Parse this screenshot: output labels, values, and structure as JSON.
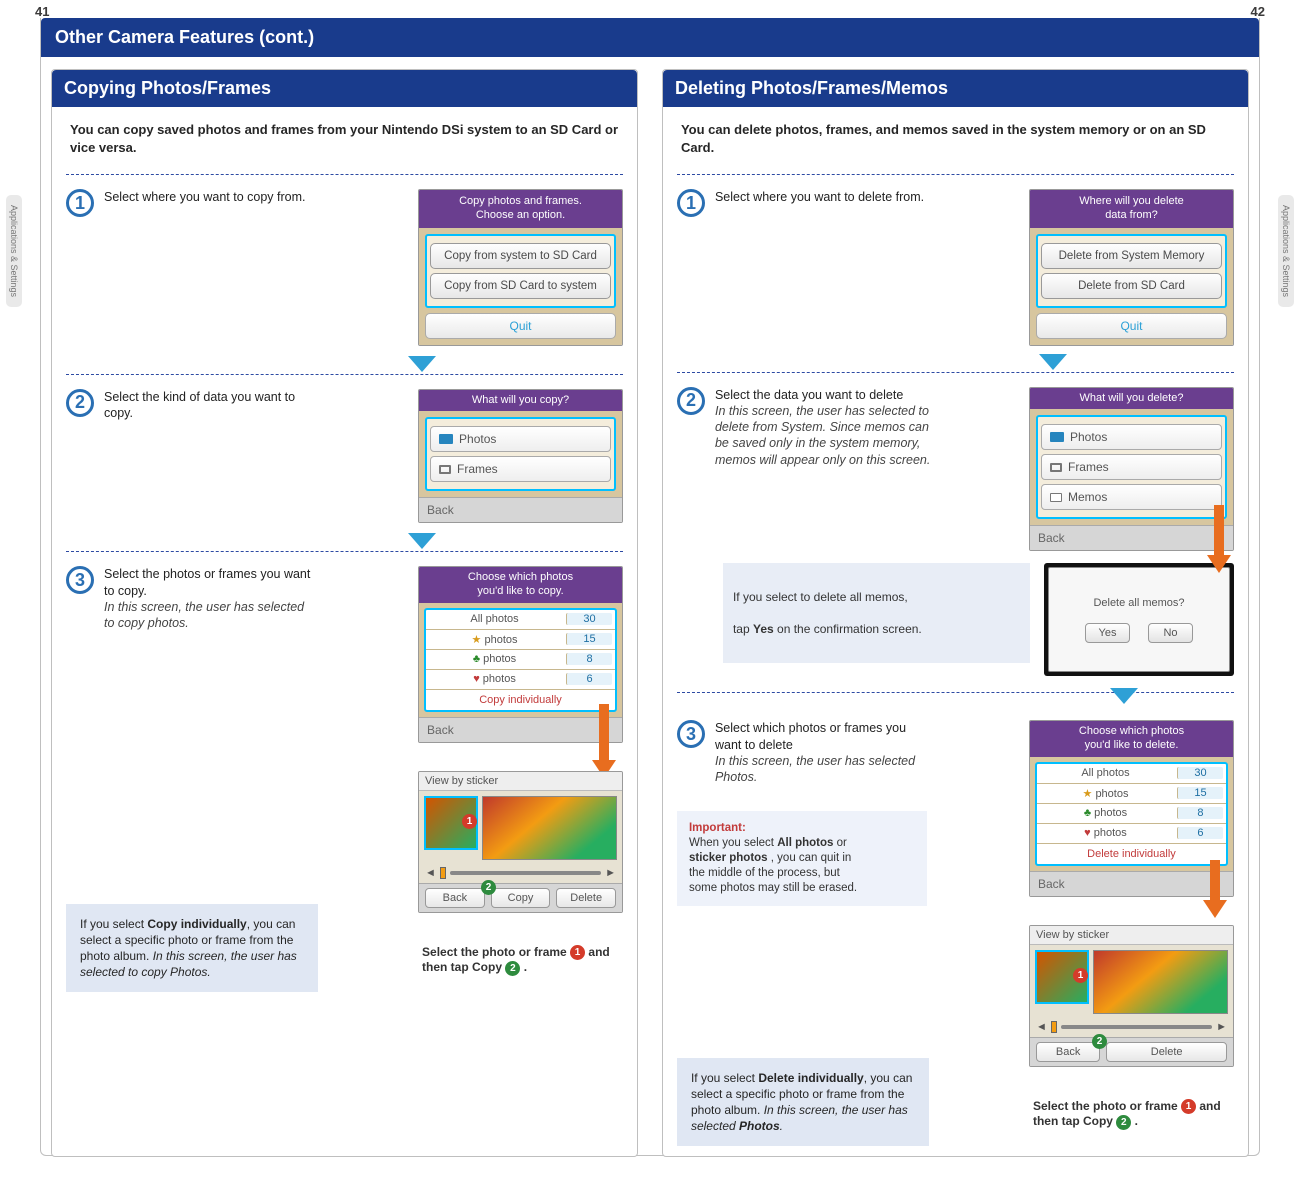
{
  "page_left": "41",
  "page_right": "42",
  "side_tab": "Applications & Settings",
  "title_bar": "Other Camera Features (cont.)",
  "left": {
    "section_title": "Copying Photos/Frames",
    "intro": "You can copy saved photos and frames from your Nintendo DSi system to an SD Card or vice versa.",
    "step1": {
      "n": "1",
      "text": "Select where you want to copy from.",
      "screen": {
        "header1": "Copy photos and frames.",
        "header2": "Choose an option.",
        "opt1": "Copy from system to SD Card",
        "opt2": "Copy from SD Card to system",
        "quit": "Quit"
      }
    },
    "step2": {
      "n": "2",
      "text": "Select the kind of data you want to copy.",
      "screen": {
        "header": "What will you copy?",
        "item1": "Photos",
        "item2": "Frames",
        "back": "Back"
      }
    },
    "step3": {
      "n": "3",
      "text": "Select the photos or frames you want to copy.",
      "subtext": "In this screen, the user has selected to copy photos.",
      "screen": {
        "header1a": "Choose which photos",
        "header1b": "you'd like to copy.",
        "rows": [
          {
            "label": "All photos",
            "count": "30"
          },
          {
            "label": "photos",
            "count": "15",
            "sym": "★",
            "cls": "star"
          },
          {
            "label": "photos",
            "count": "8",
            "sym": "♣",
            "cls": "club"
          },
          {
            "label": "photos",
            "count": "6",
            "sym": "♥",
            "cls": "heart"
          }
        ],
        "action": "Copy individually",
        "back": "Back"
      },
      "note_prefix": "If you select ",
      "note_bold1": "Copy individually",
      "note_mid": ", you can select a specific photo or frame from the photo album. ",
      "note_ital": "In this screen, the user has selected to copy Photos.",
      "view_screen": {
        "header": "View by sticker",
        "bar_back": "Back",
        "bar_copy": "Copy",
        "bar_delete": "Delete"
      },
      "foot_pre": "Select the photo or frame ",
      "foot_mid": " and then tap ",
      "foot_copy": "Copy",
      "foot_end": " ."
    }
  },
  "right": {
    "section_title": "Deleting Photos/Frames/Memos",
    "intro": "You can delete photos, frames, and memos saved in the system memory or on an SD Card.",
    "step1": {
      "n": "1",
      "text": "Select where you want to delete from.",
      "screen": {
        "header1": "Where will you delete",
        "header2": "data from?",
        "opt1": "Delete from System Memory",
        "opt2": "Delete from SD Card",
        "quit": "Quit"
      }
    },
    "step2": {
      "n": "2",
      "text": "Select the data you want to delete",
      "subtext": "In this screen, the user has selected to delete from System. Since memos can be saved only in the system memory, memos will appear only on this screen.",
      "screen": {
        "header": "What will you delete?",
        "item1": "Photos",
        "item2": "Frames",
        "item3": "Memos",
        "back": "Back"
      },
      "memo_note_a": "If you select to delete all memos,",
      "memo_note_b": "tap ",
      "memo_note_yes": "Yes",
      "memo_note_c": " on the confirmation screen.",
      "confirm": {
        "q": "Delete all memos?",
        "yes": "Yes",
        "no": "No"
      }
    },
    "step3": {
      "n": "3",
      "text": "Select which photos or frames you want to delete",
      "subtext": "In this screen, the user has selected Photos.",
      "screen": {
        "header1a": "Choose which photos",
        "header1b": "you'd like to delete.",
        "rows": [
          {
            "label": "All photos",
            "count": "30"
          },
          {
            "label": "photos",
            "count": "15",
            "sym": "★",
            "cls": "star"
          },
          {
            "label": "photos",
            "count": "8",
            "sym": "♣",
            "cls": "club"
          },
          {
            "label": "photos",
            "count": "6",
            "sym": "♥",
            "cls": "heart"
          }
        ],
        "action": "Delete individually",
        "back": "Back"
      },
      "important_label": "Important:",
      "important_pre": "When you select ",
      "important_b1": "All photos",
      "important_or": " or ",
      "important_b2": "sticker photos",
      "important_post": ", you can quit in the middle of the process, but some photos may still be erased.",
      "note_prefix": "If you select ",
      "note_bold1": "Delete individually",
      "note_mid": ", you can select a specific photo or frame from the photo album. ",
      "note_ital_a": "In this screen, the user has selected ",
      "note_ital_b": "Photos",
      "note_ital_c": ".",
      "view_screen": {
        "header": "View by sticker",
        "bar_back": "Back",
        "bar_delete": "Delete"
      },
      "foot_pre": "Select the photo or frame ",
      "foot_mid": " and then tap ",
      "foot_copy": "Copy",
      "foot_end": " .",
      "badge1": "1",
      "badge2": "2"
    }
  },
  "badge1": "1",
  "badge2": "2"
}
